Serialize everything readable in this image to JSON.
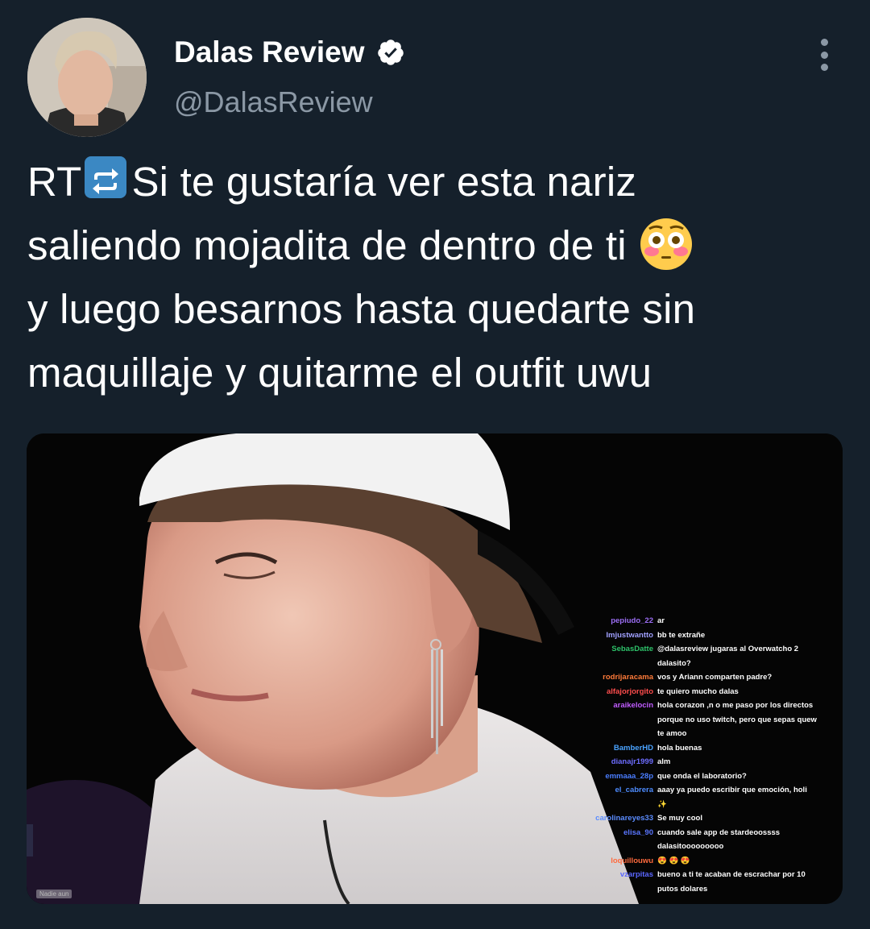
{
  "author": {
    "name": "Dalas Review",
    "handle": "@DalasReview",
    "verified_icon": "verified-badge-icon"
  },
  "tweet": {
    "lines": [
      {
        "before": "RT",
        "after": "Si te gustaría ver esta nariz"
      },
      {
        "text": "saliendo mojadita de dentro de ti"
      },
      {
        "text": "y luego besarnos hasta quedarte sin"
      },
      {
        "text": "maquillaje y quitarme el outfit uwu"
      }
    ]
  },
  "media": {
    "bottom_tag": "Nadie aun",
    "chat": [
      {
        "user": "pepiudo_22",
        "msg": "ar",
        "color": "#9c6ef5"
      },
      {
        "user": "Imjustwantto",
        "msg": "bb te extrañe",
        "color": "#a0a0ff"
      },
      {
        "user": "SebasDatte",
        "msg": "@dalasreview jugaras al Overwatcho 2",
        "color": "#2ec26a"
      },
      {
        "user": "",
        "msg": "dalasito?",
        "color": "#ffffff"
      },
      {
        "user": "rodrijaracama",
        "msg": "vos y Ariann comparten padre?",
        "color": "#ff7b3a"
      },
      {
        "user": "alfajorjorgito",
        "msg": "te quiero mucho dalas",
        "color": "#ff4d4d"
      },
      {
        "user": "araikelocin",
        "msg": "hola corazon ,n o me paso por los directos",
        "color": "#c05cff"
      },
      {
        "user": "",
        "msg": "porque no uso twitch, pero que sepas quew",
        "color": "#ffffff"
      },
      {
        "user": "",
        "msg": "te amoo",
        "color": "#ffffff"
      },
      {
        "user": "BamberHD",
        "msg": "hola buenas",
        "color": "#4aa3ff"
      },
      {
        "user": "dianajr1999",
        "msg": "alm",
        "color": "#6d6dff"
      },
      {
        "user": "emmaaa_28p",
        "msg": "que onda el laboratorio?",
        "color": "#4a7dff"
      },
      {
        "user": "el_cabrera",
        "msg": "aaay ya puedo escribir que emoción, holi",
        "color": "#4d8cff"
      },
      {
        "user": "",
        "msg": "✨",
        "color": "#ffffff"
      },
      {
        "user": "carolinareyes33",
        "msg": "Se muy cool",
        "color": "#5b8cff"
      },
      {
        "user": "elisa_90",
        "msg": "cuando sale app de stardeoossss",
        "color": "#5a76ff"
      },
      {
        "user": "",
        "msg": "dalasitooooooooo",
        "color": "#ffffff"
      },
      {
        "user": "loquillouwu",
        "msg": "😍 😍 😍",
        "color": "#ff6a3d"
      },
      {
        "user": "vzarpitas",
        "msg": "bueno a ti te acaban de escrachar por 10",
        "color": "#5a66ff"
      },
      {
        "user": "",
        "msg": "putos dolares",
        "color": "#ffffff"
      }
    ]
  }
}
